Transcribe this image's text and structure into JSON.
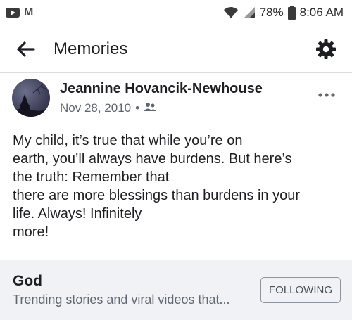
{
  "status_bar": {
    "battery": "78%",
    "time": "8:06 AM",
    "icons": [
      "youtube-icon",
      "gmail-icon",
      "wifi-icon",
      "signal-icon",
      "battery-icon"
    ]
  },
  "app_bar": {
    "title": "Memories",
    "icons": [
      "back-arrow-icon",
      "gear-icon"
    ]
  },
  "post": {
    "author": "Jeannine Hovancik-Newhouse",
    "date": "Nov 28, 2010",
    "separator": "•",
    "privacy_icon": "friends-icon",
    "more_icon": "more-icon",
    "body": "My child,  it’s true that while you’re on\nearth, you’ll always have burdens. But here’s\nthe truth: Remember that\nthere are more blessings than burdens in your\nlife. Always! Infinitely\nmore!"
  },
  "page_card": {
    "name": "God",
    "description": "Trending stories and viral videos that...",
    "button_label": "FOLLOWING"
  },
  "colors": {
    "text_primary": "#1c1e21",
    "text_secondary": "#606770",
    "card_background": "#f0f2f5",
    "divider": "#dadde1"
  }
}
